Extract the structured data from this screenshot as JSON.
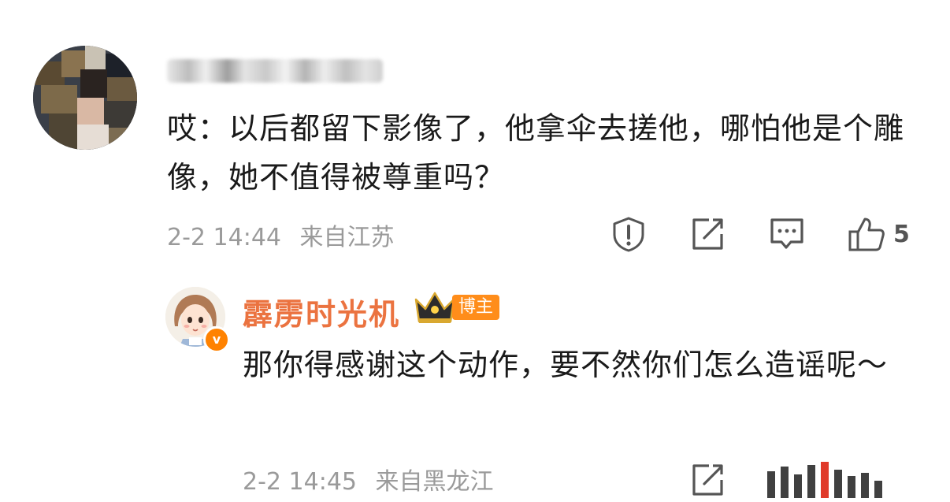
{
  "main_comment": {
    "comment_text": "哎：以后都留下影像了，他拿伞去搓他，哪怕他是个雕像，她不值得被尊重吗？",
    "date": "2-2 14:44",
    "location": "来自江苏",
    "like_count": "5",
    "icons": [
      "report-icon",
      "share-icon",
      "reply-icon",
      "like-icon"
    ]
  },
  "reply": {
    "username": "霹雳时光机",
    "verified_badge": "v",
    "blogger_badge": "博主",
    "comment_text": "那你得感谢这个动作，要不然你们怎么造谣呢～",
    "date": "2-2 14:45",
    "location": "来自黑龙江",
    "icons": [
      "share-icon"
    ]
  },
  "colors": {
    "username_reply": "#eb7340",
    "meta_gray": "#9a9a9a",
    "badge_orange": "#ff8d1a",
    "verified_orange": "#ff8200"
  }
}
